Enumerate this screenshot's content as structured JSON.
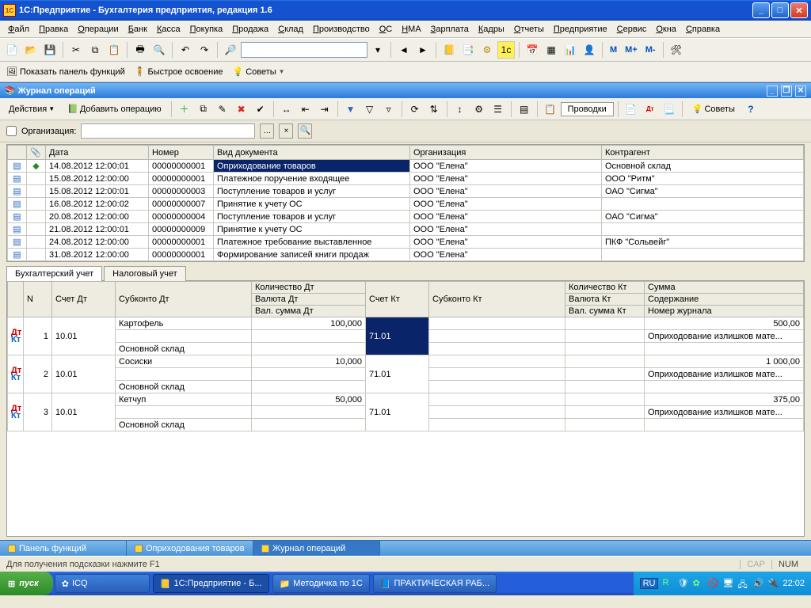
{
  "title": "1С:Предприятие - Бухгалтерия предприятия, редакция 1.6",
  "menu": [
    "Файл",
    "Правка",
    "Операции",
    "Банк",
    "Касса",
    "Покупка",
    "Продажа",
    "Склад",
    "Производство",
    "ОС",
    "НМА",
    "Зарплата",
    "Кадры",
    "Отчеты",
    "Предприятие",
    "Сервис",
    "Окна",
    "Справка"
  ],
  "toolbar_m": {
    "m": "М",
    "mplus": "М+",
    "mminus": "М-"
  },
  "toolbar2": {
    "show_panel": "Показать панель функций",
    "quick": "Быстрое освоение",
    "tips": "Советы"
  },
  "doc_title": "Журнал операций",
  "toolbar3": {
    "actions": "Действия",
    "add_op": "Добавить операцию",
    "entries_btn": "Проводки",
    "tips": "Советы"
  },
  "filter": {
    "org_label": "Организация:"
  },
  "grid_headers": {
    "c1": "",
    "c2": "",
    "c3": "Дата",
    "c4": "Номер",
    "c5": "Вид документа",
    "c6": "Организация",
    "c7": "Контрагент"
  },
  "rows": [
    {
      "date": "14.08.2012 12:00:01",
      "num": "00000000001",
      "doc": "Оприходование товаров",
      "org": "ООО \"Елена\"",
      "kont": "Основной склад",
      "sel": true
    },
    {
      "date": "15.08.2012 12:00:00",
      "num": "00000000001",
      "doc": "Платежное поручение входящее",
      "org": "ООО \"Елена\"",
      "kont": "ООО \"Ритм\""
    },
    {
      "date": "15.08.2012 12:00:01",
      "num": "00000000003",
      "doc": "Поступление товаров и услуг",
      "org": "ООО \"Елена\"",
      "kont": "ОАО \"Сигма\""
    },
    {
      "date": "16.08.2012 12:00:02",
      "num": "00000000007",
      "doc": "Принятие к учету ОС",
      "org": "ООО \"Елена\"",
      "kont": ""
    },
    {
      "date": "20.08.2012 12:00:00",
      "num": "00000000004",
      "doc": "Поступление товаров и услуг",
      "org": "ООО \"Елена\"",
      "kont": "ОАО \"Сигма\""
    },
    {
      "date": "21.08.2012 12:00:01",
      "num": "00000000009",
      "doc": "Принятие к учету ОС",
      "org": "ООО \"Елена\"",
      "kont": ""
    },
    {
      "date": "24.08.2012 12:00:00",
      "num": "00000000001",
      "doc": "Платежное требование выставленное",
      "org": "ООО \"Елена\"",
      "kont": "ПКФ \"Сольвейг\""
    },
    {
      "date": "31.08.2012 12:00:00",
      "num": "00000000001",
      "doc": "Формирование записей книги продаж",
      "org": "ООО \"Елена\"",
      "kont": ""
    }
  ],
  "tabs": {
    "t1": "Бухгалтерский учет",
    "t2": "Налоговый учет"
  },
  "detail_h1": {
    "n": "N",
    "sdt": "Счет Дт",
    "subdt": "Субконто Дт",
    "koldt": "Количество Дт",
    "skt": "Счет Кт",
    "subkt": "Субконто Кт",
    "kolkt": "Количество Кт",
    "sum": "Сумма"
  },
  "detail_h2": {
    "valdt": "Валюта Дт",
    "valkt": "Валюта Кт",
    "sod": "Содержание"
  },
  "detail_h3": {
    "vsdt": "Вал. сумма Дт",
    "vskt": "Вал. сумма Кт",
    "journ": "Номер журнала"
  },
  "detail_rows": [
    {
      "n": "1",
      "sdt": "10.01",
      "sub1": "Картофель",
      "sub3": "Основной склад",
      "kol": "100,000",
      "skt": "71.01",
      "sum": "500,00",
      "sod": "Оприходование излишков мате...",
      "sel": true
    },
    {
      "n": "2",
      "sdt": "10.01",
      "sub1": "Сосиски",
      "sub3": "Основной склад",
      "kol": "10,000",
      "skt": "71.01",
      "sum": "1 000,00",
      "sod": "Оприходование излишков мате..."
    },
    {
      "n": "3",
      "sdt": "10.01",
      "sub1": "Кетчуп",
      "sub3": "Основной склад",
      "kol": "50,000",
      "skt": "71.01",
      "sum": "375,00",
      "sod": "Оприходование излишков мате..."
    }
  ],
  "wintabs": [
    {
      "label": "Панель функций"
    },
    {
      "label": "Оприходования товаров"
    },
    {
      "label": "Журнал операций",
      "active": true
    }
  ],
  "status": {
    "hint": "Для получения подсказки нажмите F1",
    "cap": "CAP",
    "num": "NUM"
  },
  "taskbar": {
    "start": "пуск",
    "items": [
      {
        "label": "ICQ"
      },
      {
        "label": "1С:Предприятие - Б...",
        "active": true
      },
      {
        "label": "Методичка по 1С"
      },
      {
        "label": "ПРАКТИЧЕСКАЯ РАБ..."
      }
    ],
    "lang": "RU",
    "time": "22:02"
  }
}
